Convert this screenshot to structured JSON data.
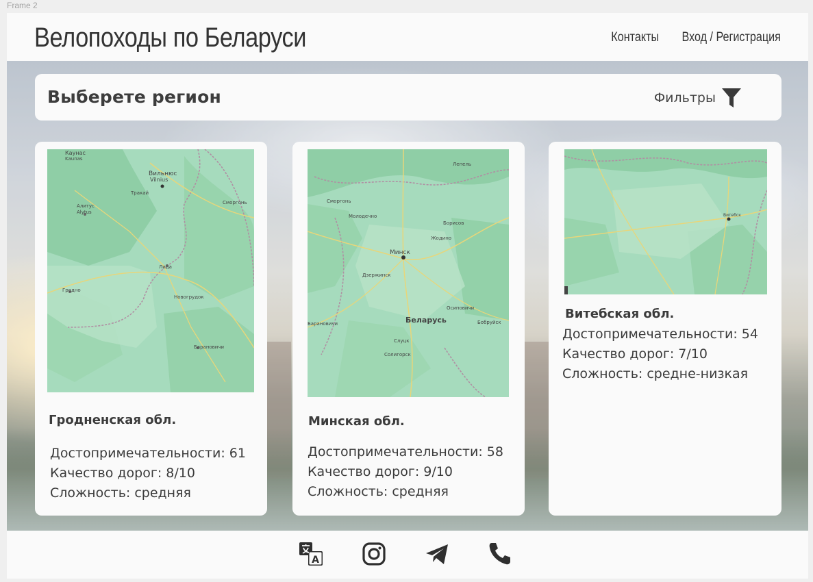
{
  "frame_label": "Frame 2",
  "header": {
    "title": "Велопоходы по Беларуси",
    "nav": {
      "contacts": "Контакты",
      "login": "Вход / Регистрация"
    }
  },
  "region_bar": {
    "title": "Выберете регион",
    "filters_label": "Фильтры",
    "filters_icon": "funnel-icon"
  },
  "regions": [
    {
      "name": "Гродненская обл.",
      "sights": "Достопримечательности: 61",
      "roads": "Качество дорог: 8/10",
      "difficulty": "Сложность: средняя",
      "map_labels": [
        "Каунас",
        "Kaunas",
        "Вильнюс",
        "Vilnius",
        "Тракай",
        "Алитус",
        "Alytus",
        "Сморгонь",
        "Лида",
        "Гродно",
        "Новогрудок",
        "Барановичи"
      ]
    },
    {
      "name": "Минская обл.",
      "sights": "Достопримечательности: 58",
      "roads": "Качество дорог: 9/10",
      "difficulty": "Сложность: средняя",
      "map_labels": [
        "Лепель",
        "Сморгонь",
        "Молодечно",
        "Борисов",
        "Жодино",
        "Минск",
        "Дзержинск",
        "Барановичи",
        "Беларусь",
        "Бобруйск",
        "Осиповичи",
        "Слуцк",
        "Солигорск"
      ]
    },
    {
      "name": "Витебская обл.",
      "sights": "Достопримечательности: 54",
      "roads": "Качество дорог: 7/10",
      "difficulty": "Сложность: средне-низкая",
      "map_labels": [
        "Витебск"
      ]
    }
  ],
  "footer": {
    "icons": [
      "translate-icon",
      "instagram-icon",
      "telegram-icon",
      "phone-icon"
    ]
  },
  "colors": {
    "background": "#fafafa",
    "text": "#3b3b3b",
    "map_green": "#a8dcc0"
  }
}
